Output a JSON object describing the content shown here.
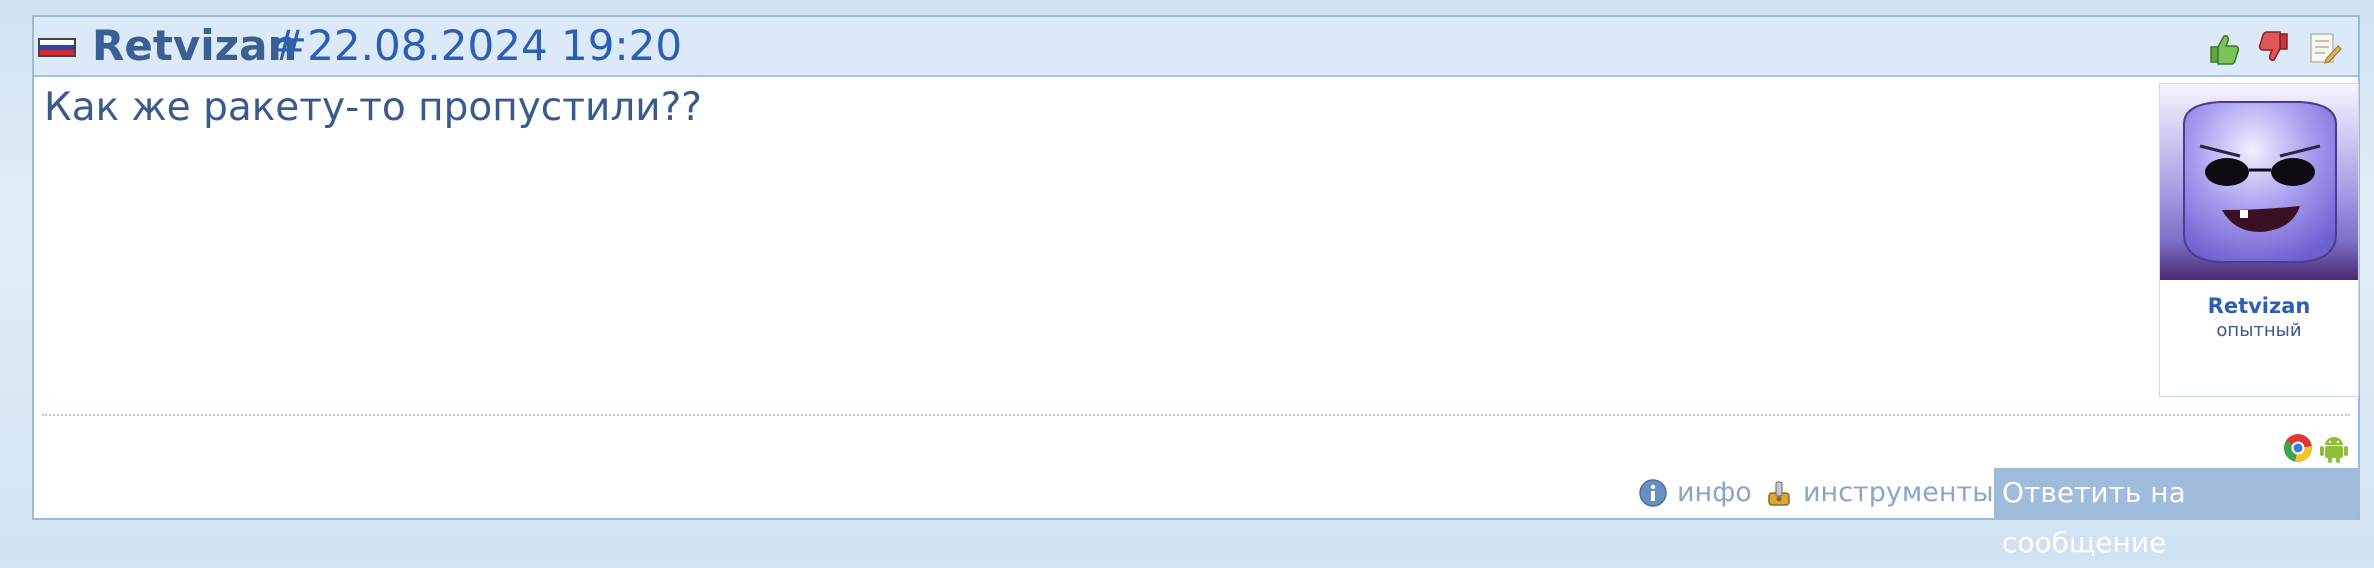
{
  "post": {
    "author": "Retvizan",
    "date": "#22.08.2024 19:20",
    "message": "Как же ракету-то пропустили??"
  },
  "header_icons": [
    "thumbs-up-icon",
    "thumbs-down-icon",
    "edit-note-icon"
  ],
  "profile": {
    "name": "Retvizan",
    "rank": "опытный"
  },
  "client_icons": [
    "chrome-icon",
    "android-icon"
  ],
  "footer": {
    "info_label": "инфо",
    "tools_label": "инструменты",
    "reply_label": "Ответить на сообщение"
  },
  "colors": {
    "header_bg": "#dbe9f8",
    "author": "#3a5f92",
    "date": "#2b5fb4",
    "reply_button": "#9fbcdc"
  }
}
